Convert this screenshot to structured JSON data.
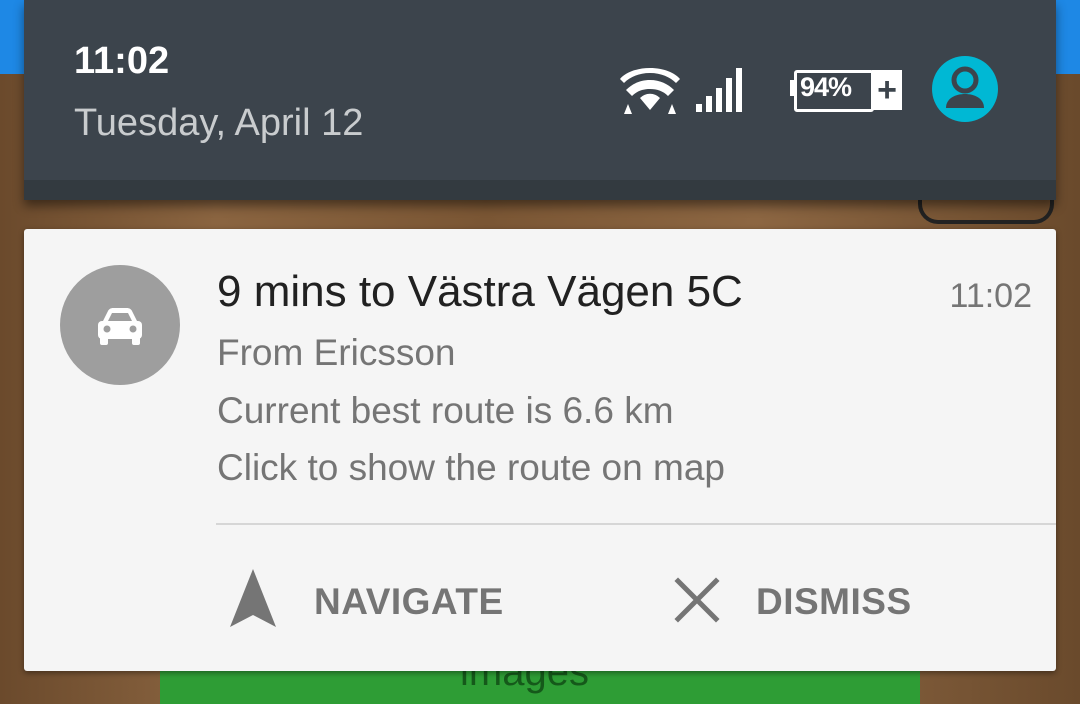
{
  "status_bar": {
    "time": "11:02",
    "date": "Tuesday, April 12",
    "battery_percent": "94%",
    "battery_charging_symbol": "+",
    "icons": [
      "wifi-icon",
      "signal-icon",
      "battery-icon",
      "avatar-icon"
    ]
  },
  "notification": {
    "icon": "car-icon",
    "title": "9 mins to Västra Vägen 5C",
    "time": "11:02",
    "lines": [
      "From Ericsson",
      "Current best route is 6.6 km",
      "Click to show the route on map"
    ],
    "actions": [
      {
        "label": "NAVIGATE",
        "icon": "navigation-arrow-icon"
      },
      {
        "label": "DISMISS",
        "icon": "close-icon"
      }
    ]
  },
  "background": {
    "partial_text": "images"
  },
  "colors": {
    "shade": "#3c444c",
    "card": "#f5f5f5",
    "accent": "#00b8d4",
    "icon_circle": "#9e9e9e"
  }
}
